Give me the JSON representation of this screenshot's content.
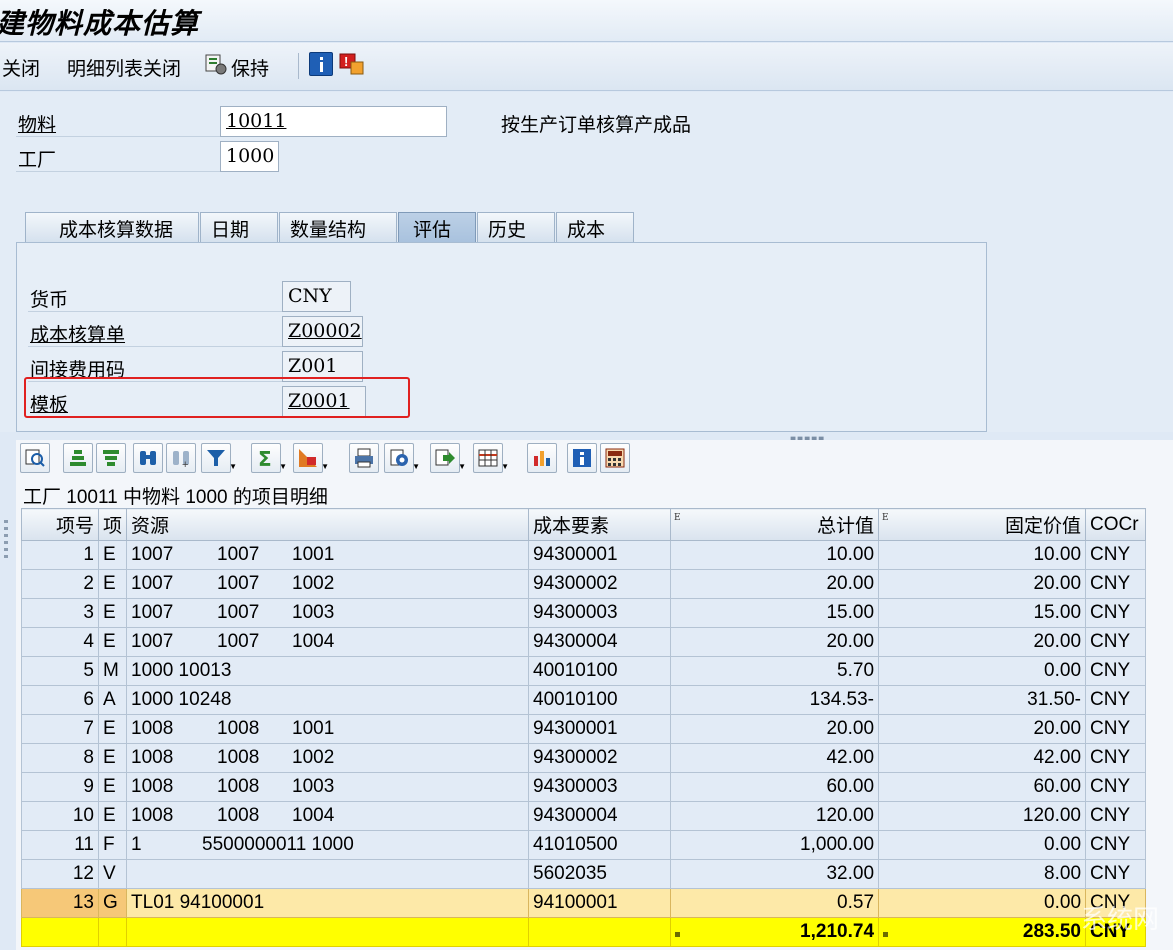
{
  "window": {
    "title": "建物料成本估算"
  },
  "toolbar": {
    "close_label": "关闭",
    "close_detail_label": "明细列表关闭",
    "save_label": "保持",
    "info_icon": "info-icon",
    "help_icon": "help-icon"
  },
  "header": {
    "material_label": "物料",
    "material_value": "10011",
    "plant_label": "工厂",
    "plant_value": "1000",
    "description": "按生产订单核算产成品"
  },
  "tabs": [
    {
      "label": "成本核算数据",
      "active": false
    },
    {
      "label": "日期",
      "active": false
    },
    {
      "label": "数量结构",
      "active": false
    },
    {
      "label": "评估",
      "active": true
    },
    {
      "label": "历史",
      "active": false
    },
    {
      "label": "成本",
      "active": false
    }
  ],
  "valuation": {
    "currency_label": "货币",
    "currency_value": "CNY",
    "costing_sheet_label": "成本核算单",
    "costing_sheet_value": "Z00002",
    "overhead_key_label": "间接费用码",
    "overhead_key_value": "Z001",
    "template_label": "模板",
    "template_value": "Z0001"
  },
  "grid": {
    "caption_prefix": "工厂",
    "caption_plant": "10011",
    "caption_mid": "中物料",
    "caption_material": "1000",
    "caption_suffix": "的项目明细",
    "columns": {
      "item_no": "项号",
      "cat": "项",
      "resource": "资源",
      "cost_element": "成本要素",
      "total": "总计值",
      "fixed": "固定价值",
      "currency": "COCr"
    },
    "rows": [
      {
        "no": "1",
        "cat": "E",
        "r1": "1007",
        "r2": "1007",
        "r3": "1001",
        "ce": "94300001",
        "total": "10.00",
        "fixed": "10.00",
        "cur": "CNY"
      },
      {
        "no": "2",
        "cat": "E",
        "r1": "1007",
        "r2": "1007",
        "r3": "1002",
        "ce": "94300002",
        "total": "20.00",
        "fixed": "20.00",
        "cur": "CNY"
      },
      {
        "no": "3",
        "cat": "E",
        "r1": "1007",
        "r2": "1007",
        "r3": "1003",
        "ce": "94300003",
        "total": "15.00",
        "fixed": "15.00",
        "cur": "CNY"
      },
      {
        "no": "4",
        "cat": "E",
        "r1": "1007",
        "r2": "1007",
        "r3": "1004",
        "ce": "94300004",
        "total": "20.00",
        "fixed": "20.00",
        "cur": "CNY"
      },
      {
        "no": "5",
        "cat": "M",
        "r1": "1000 10013",
        "r2": "",
        "r3": "",
        "ce": "40010100",
        "total": "5.70",
        "fixed": "0.00",
        "cur": "CNY"
      },
      {
        "no": "6",
        "cat": "A",
        "r1": "1000 10248",
        "r2": "",
        "r3": "",
        "ce": "40010100",
        "total": "134.53-",
        "fixed": "31.50-",
        "cur": "CNY"
      },
      {
        "no": "7",
        "cat": "E",
        "r1": "1008",
        "r2": "1008",
        "r3": "1001",
        "ce": "94300001",
        "total": "20.00",
        "fixed": "20.00",
        "cur": "CNY"
      },
      {
        "no": "8",
        "cat": "E",
        "r1": "1008",
        "r2": "1008",
        "r3": "1002",
        "ce": "94300002",
        "total": "42.00",
        "fixed": "42.00",
        "cur": "CNY"
      },
      {
        "no": "9",
        "cat": "E",
        "r1": "1008",
        "r2": "1008",
        "r3": "1003",
        "ce": "94300003",
        "total": "60.00",
        "fixed": "60.00",
        "cur": "CNY"
      },
      {
        "no": "10",
        "cat": "E",
        "r1": "1008",
        "r2": "1008",
        "r3": "1004",
        "ce": "94300004",
        "total": "120.00",
        "fixed": "120.00",
        "cur": "CNY"
      },
      {
        "no": "11",
        "cat": "F",
        "r1": "1",
        "r2": "5500000011 1000",
        "r3": "",
        "ce": "41010500",
        "total": "1,000.00",
        "fixed": "0.00",
        "cur": "CNY"
      },
      {
        "no": "12",
        "cat": "V",
        "r1": "",
        "r2": "",
        "r3": "",
        "ce": "5602035",
        "total": "32.00",
        "fixed": "8.00",
        "cur": "CNY"
      },
      {
        "no": "13",
        "cat": "G",
        "r1": "TL01 94100001",
        "r2": "",
        "r3": "",
        "ce": "94100001",
        "total": "0.57",
        "fixed": "0.00",
        "cur": "CNY"
      }
    ],
    "totals": {
      "total": "1,210.74",
      "fixed": "283.50",
      "cur": "CNY"
    }
  },
  "watermark": "系统网"
}
